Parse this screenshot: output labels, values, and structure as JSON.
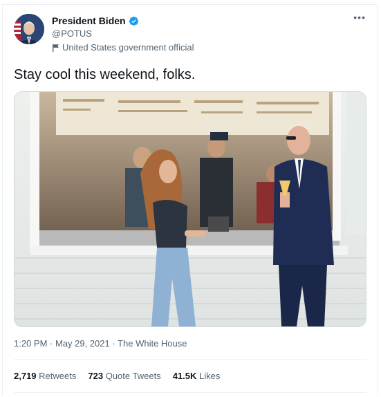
{
  "author": {
    "name": "President Biden",
    "handle": "@POTUS",
    "label": "United States government official"
  },
  "tweet": {
    "text": "Stay cool this weekend, folks.",
    "timestamp": "1:20 PM · May 29, 2021 · The White House"
  },
  "stats": {
    "retweets_count": "2,719",
    "retweets_label": "Retweets",
    "quotes_count": "723",
    "quotes_label": "Quote Tweets",
    "likes_count": "41.5K",
    "likes_label": "Likes"
  },
  "icons": {
    "more": "more-icon",
    "verified": "verified-badge-icon",
    "flag": "flag-icon"
  },
  "colors": {
    "verified": "#1d9bf0",
    "text": "#0f1419",
    "secondary": "#536471"
  }
}
